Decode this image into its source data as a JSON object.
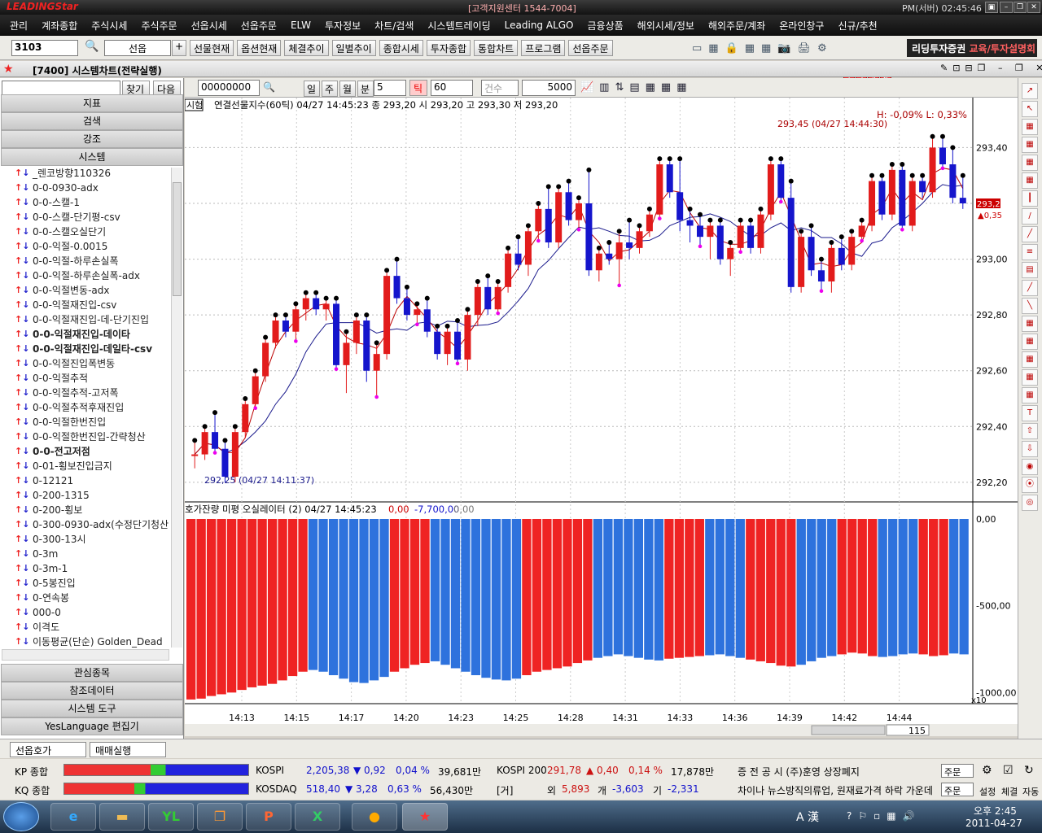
{
  "app": {
    "logo_main": "LEADING",
    "logo_star": "Star",
    "support": "[고객지원센터 1544-7004]",
    "clock": "PM(서버) 02:45:46",
    "brand_a": "리딩투자증권",
    "brand_b": "교육/투자설명회"
  },
  "menu": [
    "관리",
    "계좌종합",
    "주식시세",
    "주식주문",
    "선옵시세",
    "선옵주문",
    "ELW",
    "투자정보",
    "차트/검색",
    "시스템트레이딩",
    "Leading ALGO",
    "금융상품",
    "해외시세/정보",
    "해외주문/계좌",
    "온라인창구",
    "신규/추천"
  ],
  "toolbar": {
    "code": "3103",
    "market": "선옵",
    "buttons": [
      "선물현재",
      "옵션현재",
      "체결추이",
      "일별추이",
      "종합시세",
      "투자종합",
      "통합차트",
      "프로그램",
      "선옵주문"
    ],
    "nums": [
      "1",
      "2",
      "5",
      "6",
      "3",
      "4",
      "7",
      "8"
    ]
  },
  "window": {
    "title": "[7400] 시스템차트(전략실행)"
  },
  "left": {
    "find": "찾기",
    "next": "다음",
    "tabs": [
      "지표",
      "검색",
      "강조",
      "시스템"
    ],
    "items": [
      "_렌코방향110326",
      "0-0-0930-adx",
      "0-0-스캘-1",
      "0-0-스캘-단기평-csv",
      "0-0-스캘오실단기",
      "0-0-익절-0.0015",
      "0-0-익절-하루손실폭",
      "0-0-익절-하루손실폭-adx",
      "0-0-익절변동-adx",
      "0-0-익절재진입-csv",
      "0-0-익절재진입-데-단기진입",
      "0-0-익절재진입-데이타",
      "0-0-익절재진입-데일타-csv",
      "0-0-익절진입폭변동",
      "0-0-익절추적",
      "0-0-익절추적-고저폭",
      "0-0-익절추적후재진입",
      "0-0-익절한번진입",
      "0-0-익절한번진입-간략청산",
      "0-0-전고저점",
      "0-01-횡보진입금지",
      "0-12121",
      "0-200-1315",
      "0-200-횡보",
      "0-300-0930-adx(수정단기청산",
      "0-300-13시",
      "0-3m",
      "0-3m-1",
      "0-5봉진입",
      "0-연속봉",
      "000-0",
      "이격도",
      "이동평균(단순) Golden_Dead"
    ],
    "bold": [
      11,
      12,
      19
    ],
    "bottom_tabs": [
      "관심종목",
      "참조데이터",
      "시스템 도구",
      "YesLanguage 편집기"
    ]
  },
  "chartbar": {
    "code": "00000000",
    "tabs": [
      "일",
      "주",
      "월",
      "분",
      "틱"
    ],
    "period": "5",
    "tick": "60",
    "count_label": "건수",
    "count": "5000"
  },
  "chart_info": {
    "badge": "시험",
    "title": "연결선물지수(60틱) 04/27 14:45:23  종 293,20  시 293,20 고 293,30 저 293,20",
    "hl": "H: -0,09%   L: 0,33%",
    "hi_label": "293,45 (04/27 14:44:30)",
    "lo_label": "292,25 (04/27 14:11:37)",
    "price_tag": "293,20",
    "price_chg": "▲0,35",
    "osc_title": "호가잔량 미평 오실레이터  (2) 04/27 14:45:23",
    "osc_v1": "0,00",
    "osc_v2": "-7,700,00",
    "osc_v3": "0,00",
    "x10": "x10",
    "scroll_num": "115"
  },
  "chart_data": [
    {
      "type": "candlestick",
      "title": "연결선물지수(60틱)",
      "ylim": [
        292.15,
        293.55
      ],
      "yticks": [
        "293,40",
        "293,00",
        "292,80",
        "292,60",
        "292,40",
        "292,20"
      ],
      "yticks_extra": "293,20",
      "xticks": [
        "14:13",
        "14:15",
        "14:17",
        "14:20",
        "14:23",
        "14:25",
        "14:28",
        "14:31",
        "14:33",
        "14:36",
        "14:39",
        "14:42",
        "14:44"
      ],
      "ohlc": [
        [
          292.3,
          292.35,
          292.25,
          292.3
        ],
        [
          292.3,
          292.4,
          292.28,
          292.38
        ],
        [
          292.38,
          292.45,
          292.3,
          292.32
        ],
        [
          292.32,
          292.35,
          292.2,
          292.22
        ],
        [
          292.22,
          292.4,
          292.2,
          292.38
        ],
        [
          292.38,
          292.5,
          292.36,
          292.48
        ],
        [
          292.48,
          292.6,
          292.46,
          292.58
        ],
        [
          292.58,
          292.72,
          292.56,
          292.7
        ],
        [
          292.7,
          292.8,
          292.68,
          292.78
        ],
        [
          292.78,
          292.8,
          292.72,
          292.74
        ],
        [
          292.74,
          292.84,
          292.7,
          292.82
        ],
        [
          292.82,
          292.88,
          292.78,
          292.86
        ],
        [
          292.86,
          292.88,
          292.8,
          292.82
        ],
        [
          292.82,
          292.86,
          292.78,
          292.84
        ],
        [
          292.84,
          292.86,
          292.6,
          292.62
        ],
        [
          292.62,
          292.74,
          292.52,
          292.7
        ],
        [
          292.7,
          292.8,
          292.66,
          292.78
        ],
        [
          292.78,
          292.8,
          292.56,
          292.6
        ],
        [
          292.6,
          292.7,
          292.5,
          292.66
        ],
        [
          292.66,
          292.96,
          292.64,
          292.94
        ],
        [
          292.94,
          293.0,
          292.84,
          292.86
        ],
        [
          292.86,
          292.9,
          292.78,
          292.8
        ],
        [
          292.8,
          292.84,
          292.76,
          292.82
        ],
        [
          292.82,
          292.86,
          292.72,
          292.74
        ],
        [
          292.74,
          292.76,
          292.64,
          292.66
        ],
        [
          292.66,
          292.76,
          292.62,
          292.74
        ],
        [
          292.74,
          292.78,
          292.62,
          292.64
        ],
        [
          292.64,
          292.82,
          292.6,
          292.8
        ],
        [
          292.8,
          292.92,
          292.76,
          292.9
        ],
        [
          292.9,
          292.94,
          292.8,
          292.82
        ],
        [
          292.82,
          292.92,
          292.8,
          292.9
        ],
        [
          292.9,
          293.04,
          292.88,
          293.02
        ],
        [
          293.02,
          293.08,
          292.96,
          292.98
        ],
        [
          292.98,
          293.12,
          292.94,
          293.1
        ],
        [
          293.1,
          293.2,
          293.06,
          293.18
        ],
        [
          293.18,
          293.26,
          293.04,
          293.06
        ],
        [
          293.06,
          293.26,
          293.04,
          293.24
        ],
        [
          293.24,
          293.28,
          293.12,
          293.14
        ],
        [
          293.14,
          293.22,
          293.1,
          293.2
        ],
        [
          293.2,
          293.32,
          292.94,
          292.96
        ],
        [
          292.96,
          293.04,
          292.92,
          293.02
        ],
        [
          293.02,
          293.06,
          292.98,
          293.0
        ],
        [
          293.0,
          293.1,
          292.9,
          293.06
        ],
        [
          293.06,
          293.14,
          293.0,
          293.04
        ],
        [
          293.04,
          293.12,
          293.02,
          293.1
        ],
        [
          293.1,
          293.18,
          293.08,
          293.16
        ],
        [
          293.16,
          293.36,
          293.14,
          293.34
        ],
        [
          293.34,
          293.36,
          293.22,
          293.24
        ],
        [
          293.24,
          293.36,
          293.1,
          293.14
        ],
        [
          293.14,
          293.18,
          293.06,
          293.12
        ],
        [
          293.12,
          293.16,
          293.04,
          293.08
        ],
        [
          293.08,
          293.14,
          293.0,
          293.12
        ],
        [
          293.12,
          293.14,
          292.98,
          293.0
        ],
        [
          293.0,
          293.06,
          292.94,
          293.04
        ],
        [
          293.04,
          293.14,
          293.02,
          293.12
        ],
        [
          293.12,
          293.14,
          293.02,
          293.04
        ],
        [
          293.04,
          293.18,
          293.02,
          293.16
        ],
        [
          293.16,
          293.36,
          293.14,
          293.34
        ],
        [
          293.34,
          293.36,
          293.2,
          293.22
        ],
        [
          293.22,
          293.28,
          292.88,
          292.9
        ],
        [
          292.9,
          293.1,
          292.88,
          293.08
        ],
        [
          293.08,
          293.12,
          292.94,
          292.96
        ],
        [
          292.96,
          293.0,
          292.88,
          292.92
        ],
        [
          292.92,
          293.06,
          292.88,
          293.04
        ],
        [
          293.04,
          293.08,
          292.96,
          292.98
        ],
        [
          292.98,
          293.1,
          292.96,
          293.08
        ],
        [
          293.08,
          293.14,
          293.06,
          293.12
        ],
        [
          293.12,
          293.3,
          293.1,
          293.28
        ],
        [
          293.28,
          293.3,
          293.14,
          293.16
        ],
        [
          293.16,
          293.34,
          293.14,
          293.32
        ],
        [
          293.32,
          293.34,
          293.1,
          293.12
        ],
        [
          293.12,
          293.3,
          293.1,
          293.28
        ],
        [
          293.28,
          293.3,
          293.22,
          293.24
        ],
        [
          293.24,
          293.44,
          293.22,
          293.4
        ],
        [
          293.4,
          293.44,
          293.32,
          293.34
        ],
        [
          293.34,
          293.4,
          293.2,
          293.22
        ],
        [
          293.22,
          293.3,
          293.18,
          293.2
        ]
      ],
      "up_color": "#e21b1b",
      "down_color": "#1515cc"
    },
    {
      "type": "bar",
      "title": "호가잔량 미평 오실레이터",
      "ylim": [
        -1050,
        0
      ],
      "yticks": [
        "0,00",
        "-500,00",
        "-1000,00"
      ],
      "values": [
        -1040,
        -1035,
        -1020,
        -1010,
        -1000,
        -985,
        -970,
        -960,
        -950,
        -930,
        -905,
        -880,
        -870,
        -880,
        -900,
        -920,
        -940,
        -945,
        -930,
        -910,
        -880,
        -860,
        -840,
        -830,
        -820,
        -840,
        -860,
        -880,
        -900,
        -915,
        -925,
        -930,
        -920,
        -900,
        -880,
        -870,
        -860,
        -850,
        -830,
        -815,
        -800,
        -790,
        -780,
        -790,
        -800,
        -810,
        -815,
        -805,
        -800,
        -795,
        -790,
        -785,
        -780,
        -790,
        -800,
        -810,
        -820,
        -830,
        -845,
        -850,
        -840,
        -820,
        -800,
        -790,
        -780,
        -770,
        -775,
        -790,
        -795,
        -790,
        -780,
        -775,
        -780,
        -790,
        -785,
        -775,
        -780
      ],
      "colors": "r,r,r,r,r,r,r,r,r,r,r,r,b,b,b,b,b,b,b,b,r,r,r,r,b,b,b,b,b,b,b,b,b,r,r,r,r,r,r,r,b,b,b,b,b,b,b,r,r,r,r,b,b,b,b,r,r,r,r,r,b,b,b,b,r,r,r,r,b,b,b,b,r,r,r,b,b",
      "red": "#ef2323",
      "blue": "#2e72dd"
    }
  ],
  "bottom": {
    "tabs": [
      "선옵호가",
      "매매실행"
    ]
  },
  "market": {
    "kp": "KP 종합",
    "kq": "KQ 종합",
    "kospi": "KOSPI",
    "kospi_v": "2,205,38",
    "kospi_c": "▼ 0,92",
    "kospi_p": "0,04 %",
    "kospi_vol": "39,681만",
    "kosdaq": "KOSDAQ",
    "kosdaq_v": "518,40",
    "kosdaq_c": "▼ 3,28",
    "kosdaq_p": "0,63 %",
    "kosdaq_vol": "56,430만",
    "k200": "KOSPI 200",
    "k200_v": "291,78",
    "k200_c": "▲ 0,40",
    "k200_p": "0,14 %",
    "k200_vol": "17,878만",
    "foreign": "[거]",
    "f1": "외",
    "f1v": "5,893",
    "f2": "개",
    "f2v": "-3,603",
    "f3": "기",
    "f3v": "-2,331",
    "news1": "증 전 공 시 (주)훈영 상장폐지",
    "news2": "차이나 뉴스방직의류업, 원재료가격 하락 가운데",
    "n_btn": "주문",
    "icons": [
      "설정",
      "체결",
      "자동"
    ]
  },
  "taskbar": {
    "time": "오후 2:45",
    "date": "2011-04-27",
    "ime": "A 漢"
  }
}
